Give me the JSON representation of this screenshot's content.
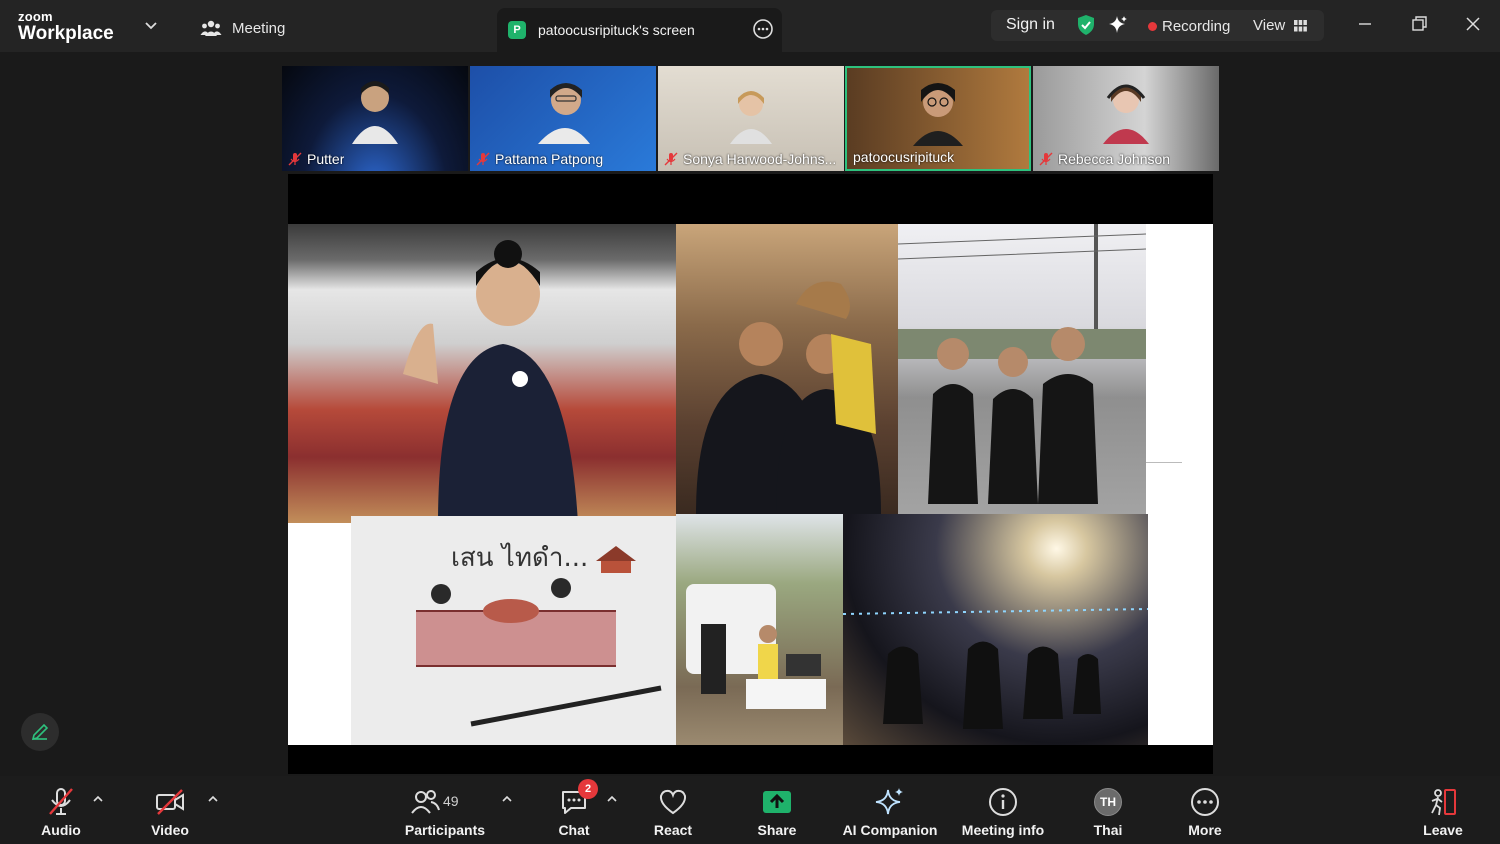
{
  "app": {
    "logo_small": "zoom",
    "logo_big": "Workplace",
    "meeting_label": "Meeting",
    "share_tab_badge": "P",
    "share_tab_label": "patoocusripituck's screen",
    "sign_in": "Sign in",
    "recording_label": "Recording",
    "view_label": "View"
  },
  "participants": [
    {
      "name": "Putter",
      "muted": true,
      "bg": "#1b2a4a"
    },
    {
      "name": "Pattama Patpong",
      "muted": true,
      "bg": "#1d4fa8"
    },
    {
      "name": "Sonya Harwood-Johns...",
      "muted": true,
      "bg": "#d8d2c8"
    },
    {
      "name": "patoocusripituck",
      "muted": false,
      "bg": "#8a5a2e",
      "active": true
    },
    {
      "name": "Rebecca Johnson",
      "muted": true,
      "bg": "#7f7f7f"
    }
  ],
  "toolbar": {
    "audio": "Audio",
    "video": "Video",
    "participants": "Participants",
    "participants_count": "49",
    "chat": "Chat",
    "chat_badge": "2",
    "react": "React",
    "share": "Share",
    "ai_companion": "AI Companion",
    "meeting_info": "Meeting info",
    "language_avatar": "TH",
    "language": "Thai",
    "more": "More",
    "leave": "Leave"
  },
  "colors": {
    "accent_green": "#1fb26b",
    "active_border": "#2ec27e",
    "recording_red": "#e5383b",
    "muted_red": "#e5383b"
  }
}
